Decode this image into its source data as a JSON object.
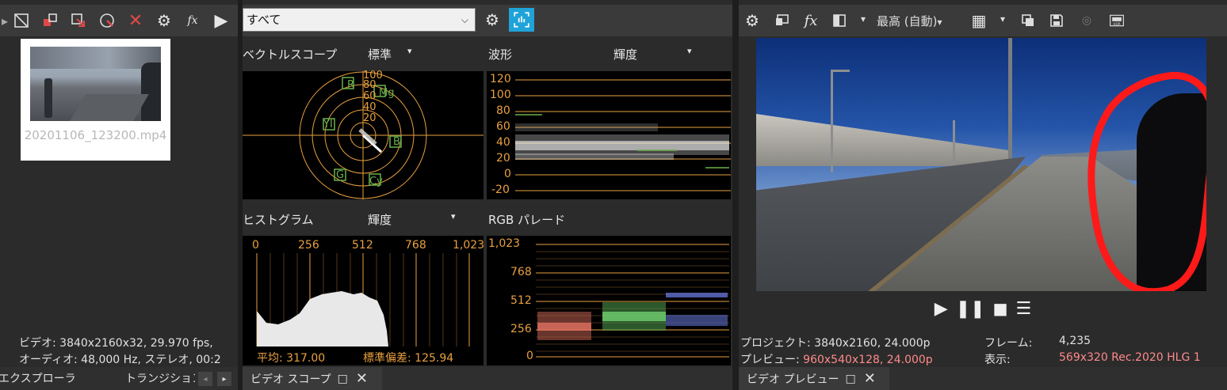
{
  "explorer": {
    "thumb_name": "20201106_123200.mp4",
    "video_info": "ビデオ: 3840x2160x32, 29.970 fps,",
    "audio_info": "オーディオ: 48,000 Hz, ステレオ, 00:2",
    "tab_explorer": "エクスプローラ",
    "tab_transition": "トランジション"
  },
  "scopes": {
    "filter_select": "すべて",
    "vector": {
      "title": "ベクトルスコープ",
      "mode": "標準",
      "labels": [
        "100",
        "80",
        "60",
        "40",
        "20"
      ],
      "targets": [
        "R",
        "Mg",
        "B",
        "Cy",
        "G",
        "YI"
      ]
    },
    "waveform": {
      "title": "波形",
      "mode": "輝度",
      "ticks": [
        "120",
        "100",
        "80",
        "60",
        "40",
        "20",
        "0",
        "-20"
      ]
    },
    "histogram": {
      "title": "ヒストグラム",
      "mode": "輝度",
      "ticks": [
        "0",
        "256",
        "512",
        "768",
        "1,023"
      ],
      "avg_label": "平均:",
      "avg_value": "317.00",
      "std_label": "標準偏差:",
      "std_value": "125.94"
    },
    "parade": {
      "title": "RGB パレード",
      "ticks": [
        "1,023",
        "768",
        "512",
        "256",
        "0"
      ]
    },
    "tab_label": "ビデオ スコープ"
  },
  "preview": {
    "quality": "最高 (自動)",
    "project_label": "プロジェクト:",
    "project_value": "3840x2160, 24.000p",
    "preview_label": "プレビュー:",
    "preview_value": "960x540x128, 24.000p",
    "frame_label": "フレーム:",
    "frame_value": "4,235",
    "display_label": "表示:",
    "display_value": "569x320 Rec.2020 HLG 1",
    "tab_label": "ビデオ プレビュー"
  }
}
